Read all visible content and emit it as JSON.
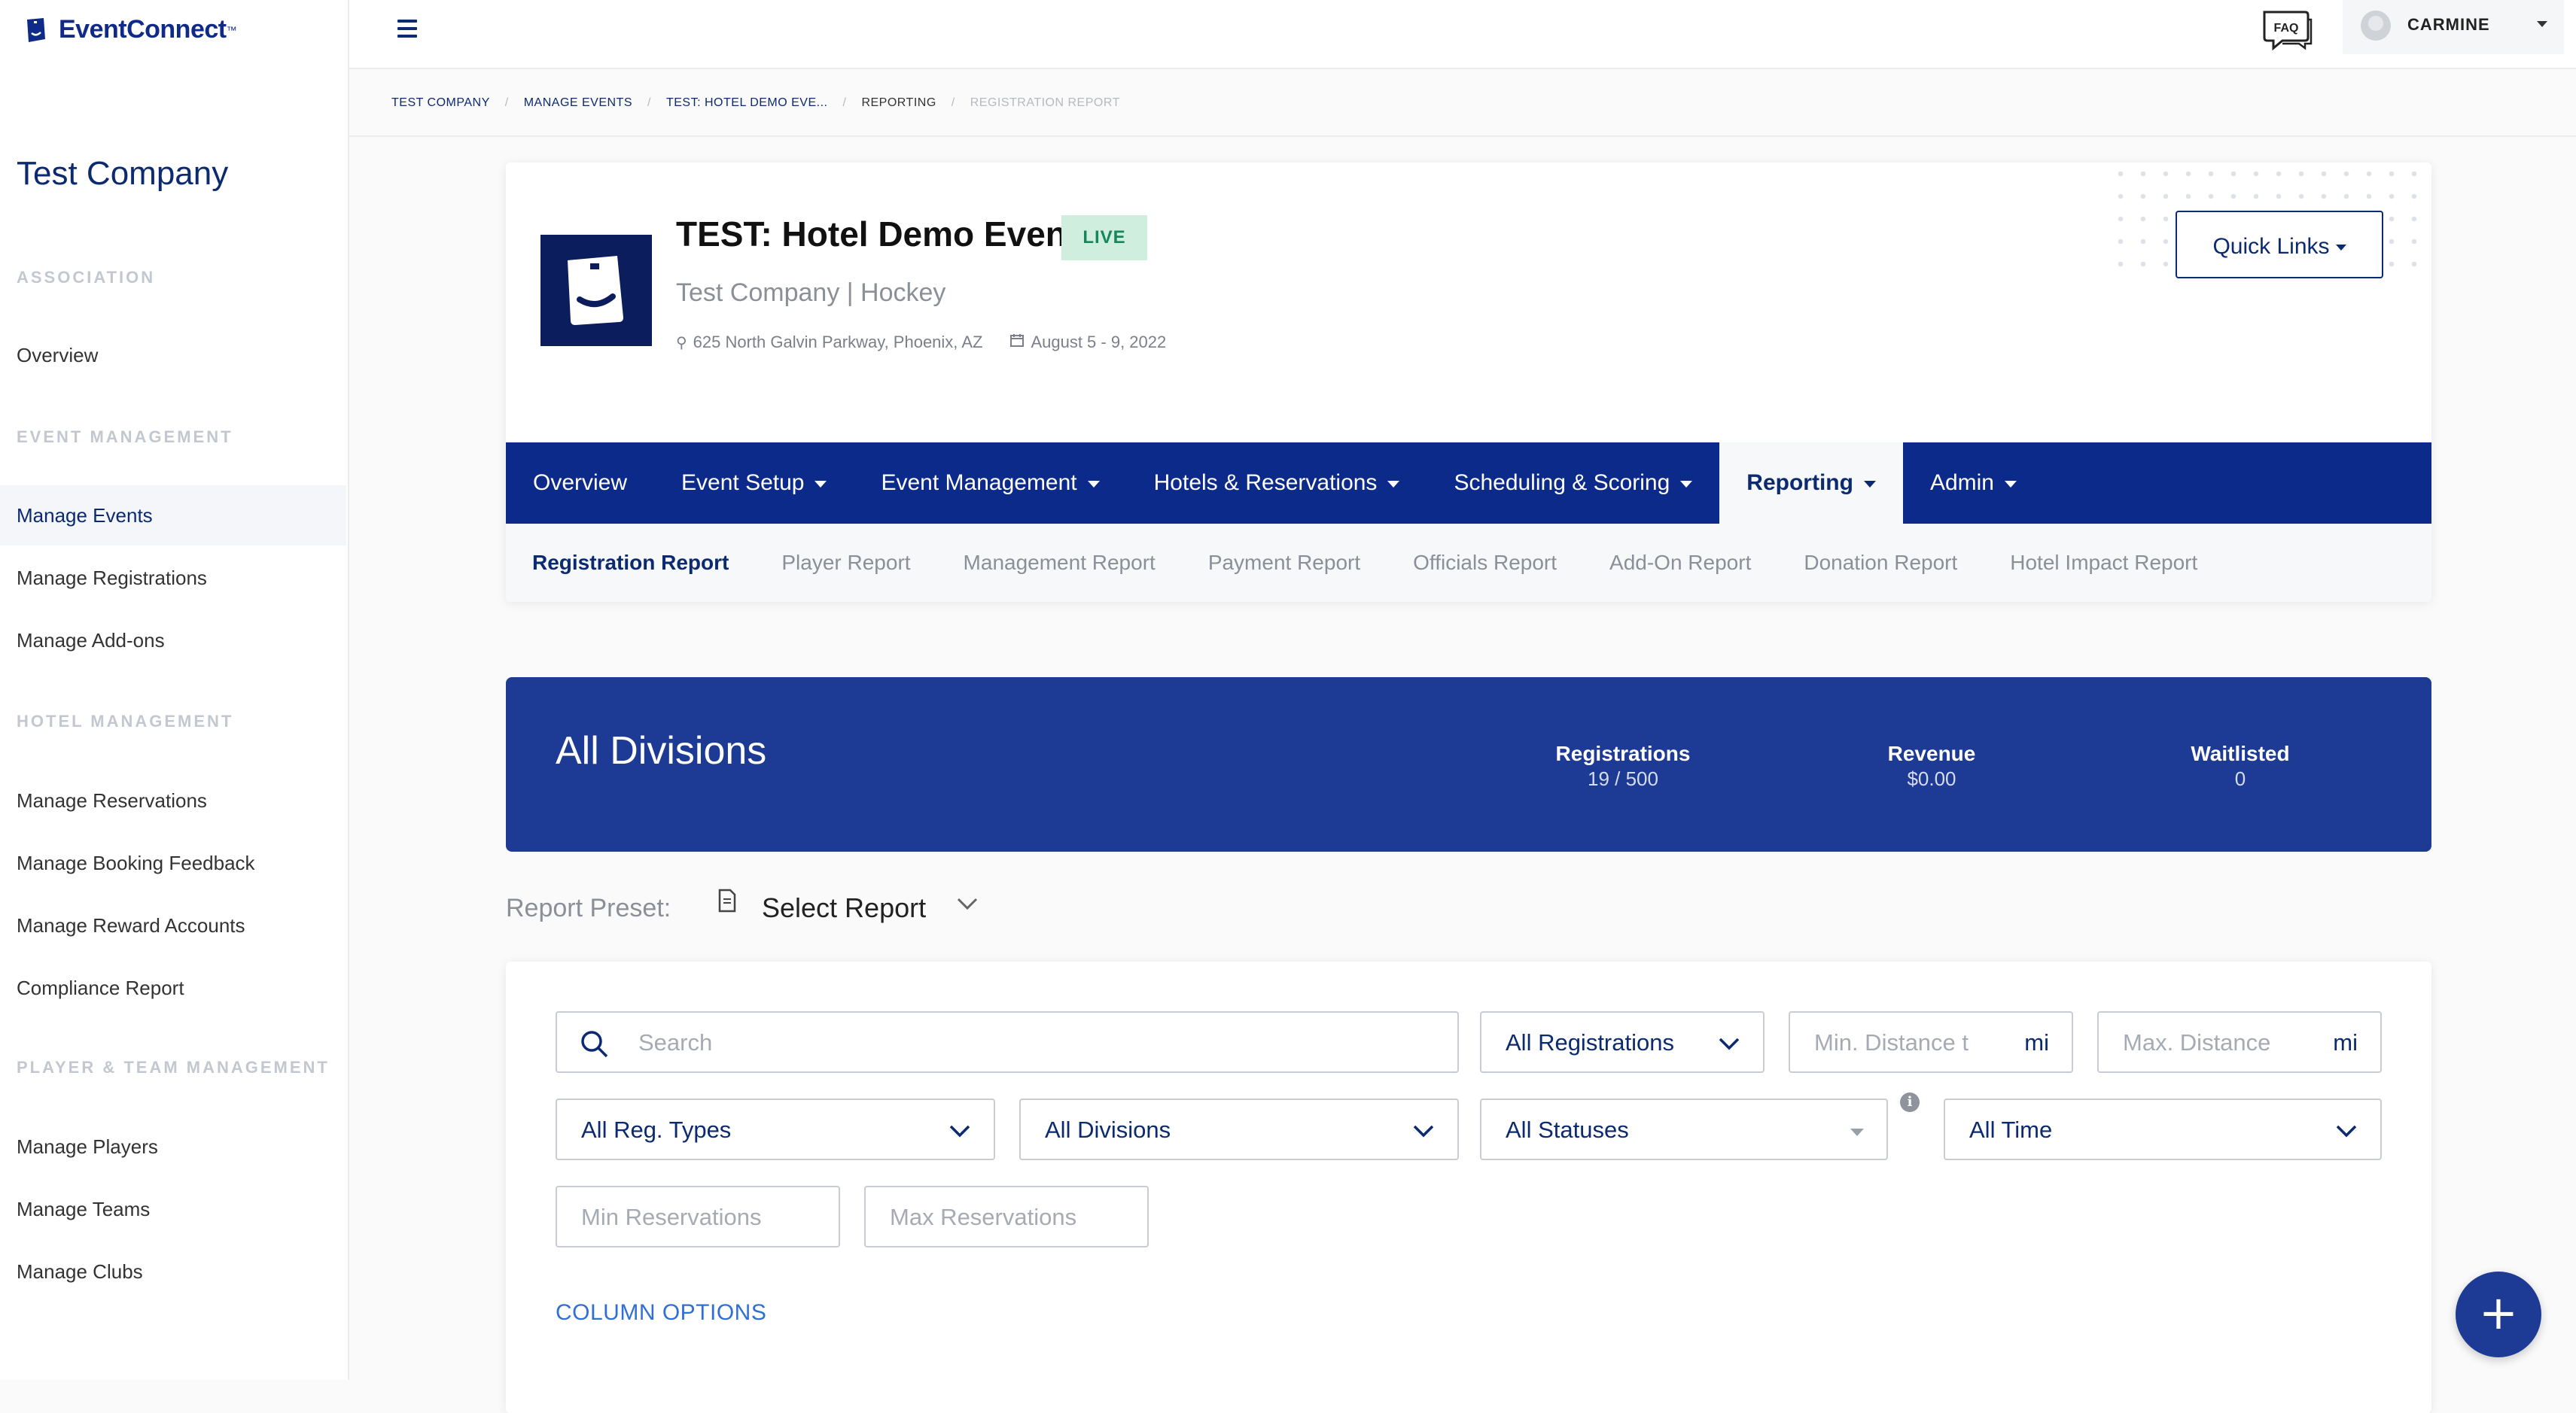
{
  "brand": {
    "name": "EventConnect",
    "tm": "™"
  },
  "sidebar": {
    "company": "Test Company",
    "sections": [
      {
        "title": "ASSOCIATION",
        "items": [
          "Overview"
        ]
      },
      {
        "title": "EVENT MANAGEMENT",
        "items": [
          "Manage Events",
          "Manage Registrations",
          "Manage Add-ons"
        ]
      },
      {
        "title": "HOTEL MANAGEMENT",
        "items": [
          "Manage Reservations",
          "Manage Booking Feedback",
          "Manage Reward Accounts",
          "Compliance Report"
        ]
      },
      {
        "title": "PLAYER & TEAM MANAGEMENT",
        "items": [
          "Manage Players",
          "Manage Teams",
          "Manage Clubs"
        ]
      }
    ],
    "active_item": "Manage Events"
  },
  "topbar": {
    "faq_label": "FAQ",
    "user_name": "CARMINE"
  },
  "breadcrumb": [
    "TEST COMPANY",
    "MANAGE EVENTS",
    "TEST: HOTEL DEMO EVE...",
    "REPORTING",
    "REGISTRATION REPORT"
  ],
  "event": {
    "title": "TEST: Hotel Demo Event",
    "status": "LIVE",
    "subtitle": "Test Company | Hockey",
    "address": "625 North Galvin Parkway, Phoenix, AZ",
    "dates": "August 5 - 9, 2022",
    "quick_links": "Quick Links"
  },
  "nav": [
    {
      "label": "Overview",
      "caret": false
    },
    {
      "label": "Event Setup",
      "caret": true
    },
    {
      "label": "Event Management",
      "caret": true
    },
    {
      "label": "Hotels & Reservations",
      "caret": true
    },
    {
      "label": "Scheduling & Scoring",
      "caret": true
    },
    {
      "label": "Reporting",
      "caret": true,
      "active": true
    },
    {
      "label": "Admin",
      "caret": true
    }
  ],
  "subnav": [
    "Registration Report",
    "Player Report",
    "Management Report",
    "Payment Report",
    "Officials Report",
    "Add-On Report",
    "Donation Report",
    "Hotel Impact Report"
  ],
  "division": {
    "title": "All Divisions",
    "stats": [
      {
        "label": "Registrations",
        "value": "19 / 500"
      },
      {
        "label": "Revenue",
        "value": "$0.00"
      },
      {
        "label": "Waitlisted",
        "value": "0"
      }
    ]
  },
  "preset": {
    "label": "Report Preset:",
    "select": "Select Report"
  },
  "filters": {
    "search_placeholder": "Search",
    "registrations": "All Registrations",
    "min_distance": "Min. Distance t",
    "max_distance": "Max. Distance",
    "distance_unit": "mi",
    "reg_types": "All Reg. Types",
    "divisions": "All Divisions",
    "statuses": "All Statuses",
    "time": "All Time",
    "min_res": "Min Reservations",
    "max_res": "Max Reservations",
    "column_options": "COLUMN OPTIONS"
  },
  "colors": {
    "primary": "#0b2a8a",
    "banner": "#1d3a94",
    "live_bg": "#cfeedd",
    "live_text": "#17865a",
    "link": "#2f6fd6"
  }
}
